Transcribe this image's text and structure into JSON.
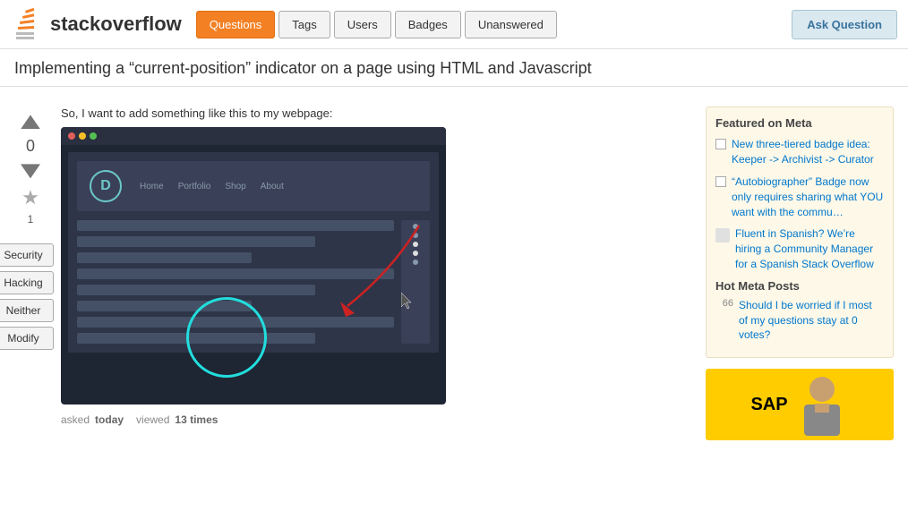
{
  "header": {
    "logo_text_regular": "stack",
    "logo_text_bold": "overflow",
    "nav": [
      {
        "label": "Questions",
        "active": true
      },
      {
        "label": "Tags",
        "active": false
      },
      {
        "label": "Users",
        "active": false
      },
      {
        "label": "Badges",
        "active": false
      },
      {
        "label": "Unanswered",
        "active": false
      }
    ],
    "ask_button": "Ask Question"
  },
  "page_title": "Implementing a “current-position” indicator on a page using HTML and Javascript",
  "question": {
    "vote_count": "0",
    "fav_count": "1",
    "body_intro": "So, I want to add something like this to my webpage:",
    "asked_label": "asked",
    "asked_value": "today",
    "viewed_label": "viewed",
    "viewed_value": "13 times"
  },
  "side_buttons": [
    {
      "label": "Security"
    },
    {
      "label": "Hacking"
    },
    {
      "label": "Neither"
    },
    {
      "label": "Modify"
    }
  ],
  "mock_browser": {
    "avatar_letter": "D",
    "nav_items": [
      "Home",
      "Portfolio",
      "Shop",
      "About"
    ]
  },
  "sidebar": {
    "featured_title": "Featured on Meta",
    "featured_items": [
      {
        "text": "New three-tiered badge idea: Keeper -> Archivist -> Curator",
        "type": "checkbox"
      },
      {
        "text": "“Autobiographer” Badge now only requires sharing what YOU want with the commu…",
        "type": "checkbox"
      },
      {
        "text": "Fluent in Spanish? We’re hiring a Community Manager for a Spanish Stack Overflow",
        "type": "icon"
      }
    ],
    "hot_meta_title": "Hot Meta Posts",
    "hot_items": [
      {
        "num": "66",
        "text": "Should I be worried if I most of my questions stay at 0 votes?"
      }
    ]
  }
}
